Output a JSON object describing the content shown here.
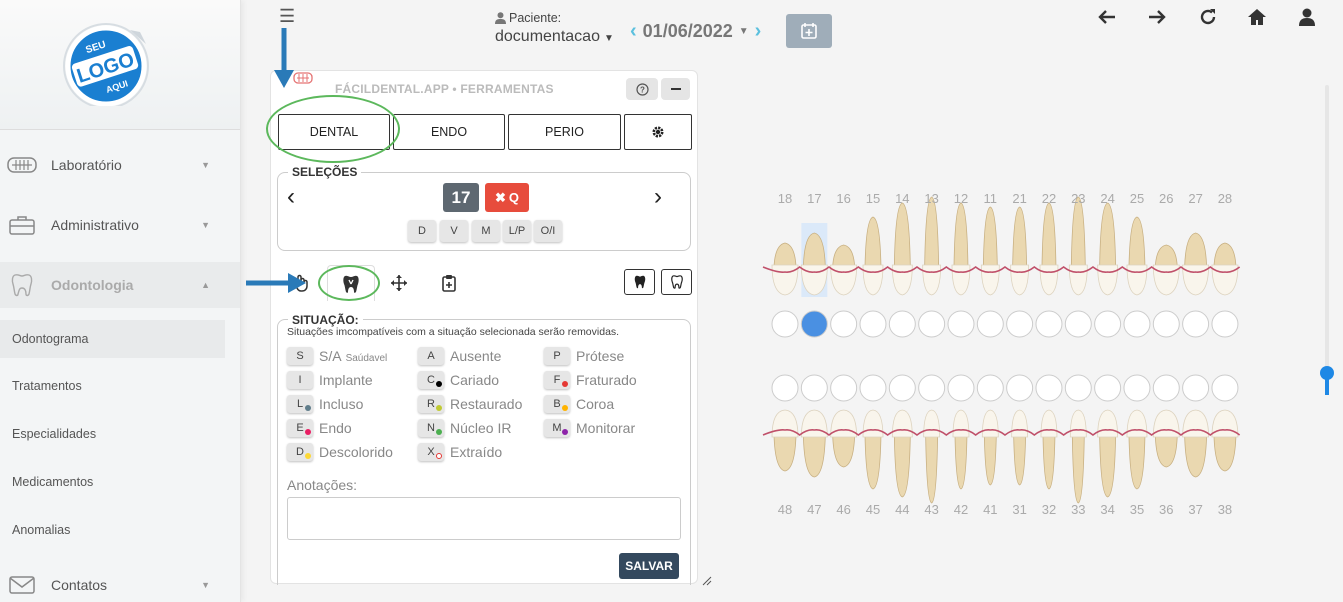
{
  "sidebar": {
    "logo": {
      "top": "SEU",
      "main": "LOGO",
      "bottom": "AQUI"
    },
    "items": [
      {
        "label": "Laboratório",
        "icon": "teeth-icon"
      },
      {
        "label": "Administrativo",
        "icon": "briefcase-icon"
      },
      {
        "label": "Odontologia",
        "icon": "tooth-icon"
      },
      {
        "label": "Contatos",
        "icon": "envelope-icon"
      }
    ],
    "subitems": [
      "Odontograma",
      "Tratamentos",
      "Especialidades",
      "Medicamentos",
      "Anomalias"
    ]
  },
  "header": {
    "patient_label": "Paciente:",
    "patient_value": "documentacao",
    "date": "01/06/2022",
    "icons": [
      "back-icon",
      "forward-icon",
      "refresh-icon",
      "home-icon",
      "user-icon"
    ]
  },
  "panel": {
    "title": "FÁCILDENTAL.APP • FERRAMENTAS",
    "modes": [
      "DENTAL",
      "ENDO",
      "PERIO"
    ],
    "selections": {
      "legend": "SELEÇÕES",
      "count": "17",
      "clear_label": "Q",
      "faces": [
        "D",
        "V",
        "M",
        "L/P",
        "O/I"
      ]
    },
    "situation": {
      "legend": "SITUAÇÃO:",
      "description": "Situações imcompatíveis com a situação selecionada serão removidas.",
      "items": [
        {
          "key": "S",
          "label": "S/A",
          "sub": "Saúdavel",
          "dot": ""
        },
        {
          "key": "A",
          "label": "Ausente",
          "sub": "",
          "dot": ""
        },
        {
          "key": "P",
          "label": "Prótese",
          "sub": "",
          "dot": ""
        },
        {
          "key": "I",
          "label": "Implante",
          "sub": "",
          "dot": ""
        },
        {
          "key": "C",
          "label": "Cariado",
          "sub": "",
          "dot": "#000000"
        },
        {
          "key": "F",
          "label": "Fraturado",
          "sub": "",
          "dot": "#e53935"
        },
        {
          "key": "L",
          "label": "Incluso",
          "sub": "",
          "dot": "#607d8b"
        },
        {
          "key": "R",
          "label": "Restaurado",
          "sub": "",
          "dot": "#c0ca33"
        },
        {
          "key": "B",
          "label": "Coroa",
          "sub": "",
          "dot": "#ffb300"
        },
        {
          "key": "E",
          "label": "Endo",
          "sub": "",
          "dot": "#e91e63"
        },
        {
          "key": "N",
          "label": "Núcleo IR",
          "sub": "",
          "dot": "#4caf50"
        },
        {
          "key": "M",
          "label": "Monitorar",
          "sub": "",
          "dot": "#8e24aa"
        },
        {
          "key": "D",
          "label": "Descolorido",
          "sub": "",
          "dot": "#fdd835"
        },
        {
          "key": "X",
          "label": "Extraído",
          "sub": "",
          "dot": "ring"
        }
      ]
    },
    "notes_label": "Anotações:",
    "save_label": "SALVAR"
  },
  "odontogram": {
    "upper": [
      "18",
      "17",
      "16",
      "15",
      "14",
      "13",
      "12",
      "11",
      "21",
      "22",
      "23",
      "24",
      "25",
      "26",
      "27",
      "28"
    ],
    "lower": [
      "48",
      "47",
      "46",
      "45",
      "44",
      "43",
      "42",
      "41",
      "31",
      "32",
      "33",
      "34",
      "35",
      "36",
      "37",
      "38"
    ],
    "selected_tooth": "17",
    "accent": "#4a90e2"
  }
}
